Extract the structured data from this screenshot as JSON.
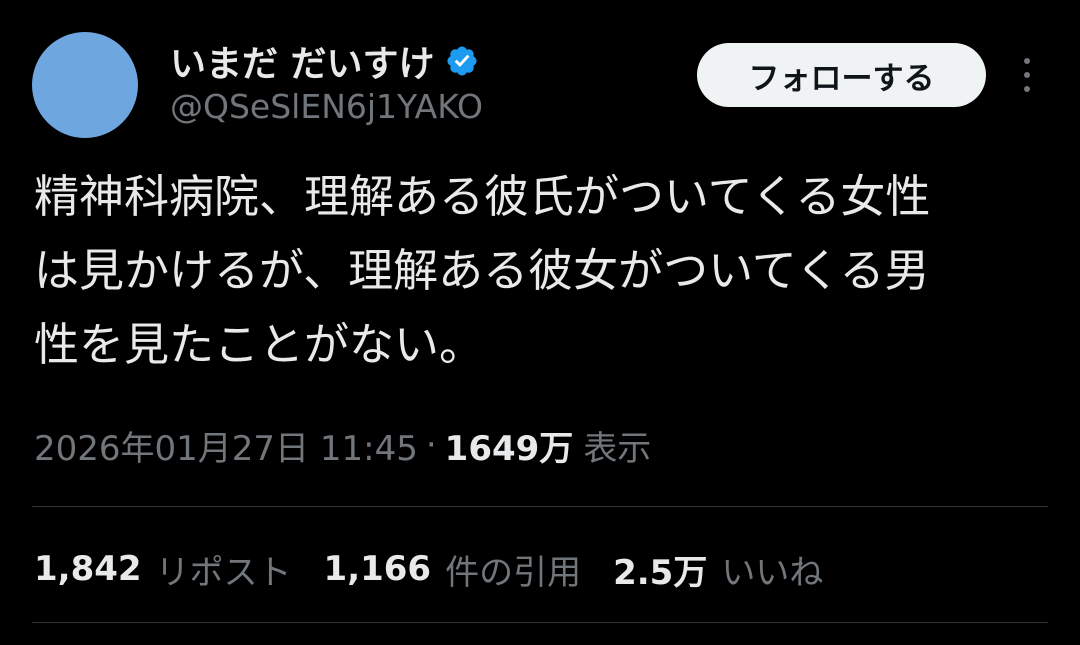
{
  "author": {
    "display_name": "いまだ だいすけ",
    "handle": "@QSeSlEN6j1YAKO",
    "verified_icon": "verified-badge-icon",
    "avatar_color": "#6ea6df",
    "verified_color": "#1d9bf0"
  },
  "actions": {
    "follow_label": "フォローする",
    "more_icon": "more-vertical-icon"
  },
  "tweet": {
    "lines": [
      "精神科病院、理解ある彼氏がついてくる女性",
      "は見かけるが、理解ある彼女がついてくる男",
      "性を見たことがない。"
    ]
  },
  "meta": {
    "timestamp": "2026年01月27日 11:45",
    "separator": "·",
    "views_count": "1649万",
    "views_label": "表示"
  },
  "stats": {
    "reposts": {
      "count": "1,842",
      "label": "リポスト"
    },
    "quotes": {
      "count": "1,166",
      "label": "件の引用"
    },
    "likes": {
      "count": "2.5万",
      "label": "いいね"
    }
  },
  "colors": {
    "background": "#000000",
    "primary_text": "#e7e9ea",
    "secondary_text": "#71767b",
    "divider": "#2f3336",
    "follow_button_bg": "#eff3f4"
  }
}
